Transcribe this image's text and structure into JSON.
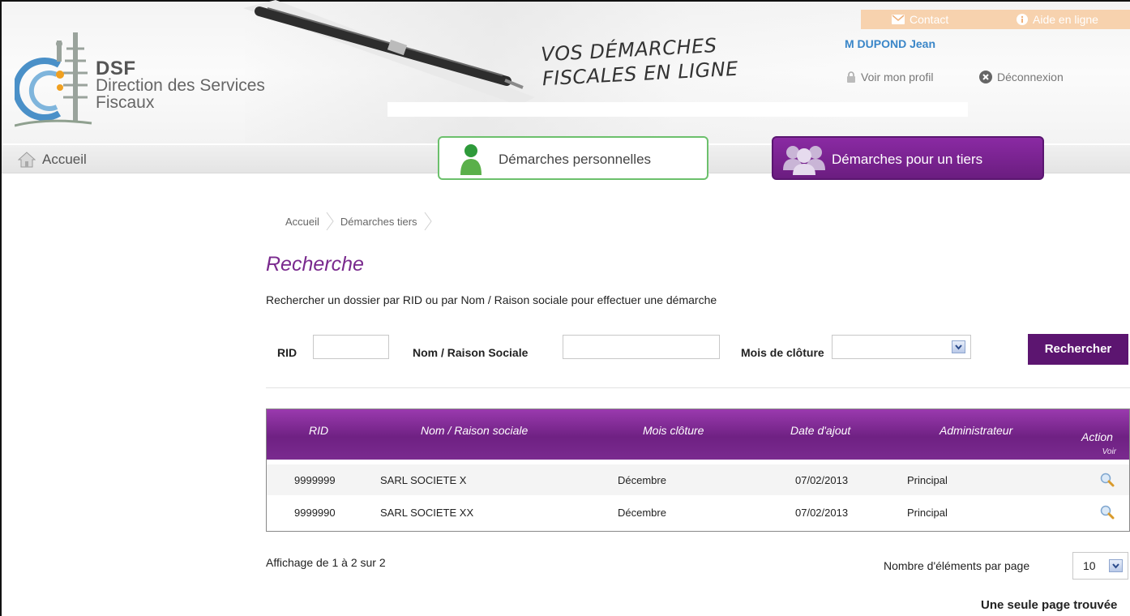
{
  "header": {
    "logo": {
      "abbr": "DSF",
      "line1": "Direction des Services",
      "line2": "Fiscaux"
    },
    "slogan": {
      "line1": "VOS DÉMARCHES",
      "line2": "FISCALES EN LIGNE"
    },
    "top_links": {
      "contact": "Contact",
      "help": "Aide en ligne"
    },
    "user": {
      "name": "M DUPOND Jean",
      "profile": "Voir mon profil",
      "logout": "Déconnexion"
    }
  },
  "nav": {
    "home": "Accueil",
    "personal": "Démarches personnelles",
    "third_party": "Démarches pour un tiers"
  },
  "breadcrumb": [
    "Accueil",
    "Démarches tiers"
  ],
  "search": {
    "title": "Recherche",
    "intro": "Rechercher un dossier par RID ou par Nom / Raison sociale pour effectuer une démarche",
    "rid_label": "RID",
    "rid_value": "",
    "name_label": "Nom / Raison Sociale",
    "name_value": "",
    "month_label": "Mois de clôture",
    "month_value": "",
    "submit": "Rechercher"
  },
  "table": {
    "headers": [
      "RID",
      "Nom / Raison sociale",
      "Mois clôture",
      "Date d'ajout",
      "Administrateur",
      "Action"
    ],
    "action_sub": "Voir",
    "rows": [
      {
        "rid": "9999999",
        "name": "SARL SOCIETE X",
        "month": "Décembre",
        "date": "07/02/2013",
        "admin": "Principal"
      },
      {
        "rid": "9999990",
        "name": "SARL SOCIETE XX",
        "month": "Décembre",
        "date": "07/02/2013",
        "admin": "Principal"
      }
    ]
  },
  "pagination": {
    "summary": "Affichage de 1 à 2 sur 2",
    "per_page_label": "Nombre d'éléments par page",
    "per_page_value": "10",
    "pages_found": "Une seule page trouvée"
  },
  "colors": {
    "accent": "#6f2183",
    "title": "#7a2a8e",
    "user_link": "#3a86c8",
    "green_border": "#6cc06c"
  }
}
